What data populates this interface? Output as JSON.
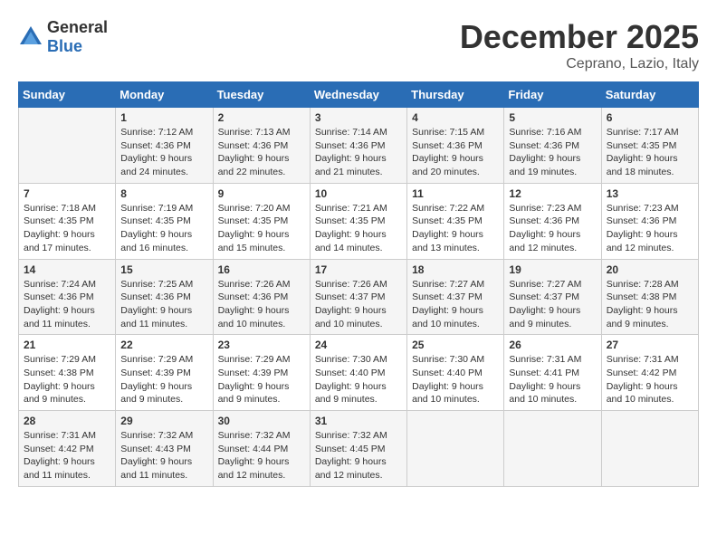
{
  "logo": {
    "general": "General",
    "blue": "Blue"
  },
  "title": "December 2025",
  "location": "Ceprano, Lazio, Italy",
  "days_header": [
    "Sunday",
    "Monday",
    "Tuesday",
    "Wednesday",
    "Thursday",
    "Friday",
    "Saturday"
  ],
  "weeks": [
    [
      {
        "day": "",
        "sunrise": "",
        "sunset": "",
        "daylight": ""
      },
      {
        "day": "1",
        "sunrise": "Sunrise: 7:12 AM",
        "sunset": "Sunset: 4:36 PM",
        "daylight": "Daylight: 9 hours and 24 minutes."
      },
      {
        "day": "2",
        "sunrise": "Sunrise: 7:13 AM",
        "sunset": "Sunset: 4:36 PM",
        "daylight": "Daylight: 9 hours and 22 minutes."
      },
      {
        "day": "3",
        "sunrise": "Sunrise: 7:14 AM",
        "sunset": "Sunset: 4:36 PM",
        "daylight": "Daylight: 9 hours and 21 minutes."
      },
      {
        "day": "4",
        "sunrise": "Sunrise: 7:15 AM",
        "sunset": "Sunset: 4:36 PM",
        "daylight": "Daylight: 9 hours and 20 minutes."
      },
      {
        "day": "5",
        "sunrise": "Sunrise: 7:16 AM",
        "sunset": "Sunset: 4:36 PM",
        "daylight": "Daylight: 9 hours and 19 minutes."
      },
      {
        "day": "6",
        "sunrise": "Sunrise: 7:17 AM",
        "sunset": "Sunset: 4:35 PM",
        "daylight": "Daylight: 9 hours and 18 minutes."
      }
    ],
    [
      {
        "day": "7",
        "sunrise": "Sunrise: 7:18 AM",
        "sunset": "Sunset: 4:35 PM",
        "daylight": "Daylight: 9 hours and 17 minutes."
      },
      {
        "day": "8",
        "sunrise": "Sunrise: 7:19 AM",
        "sunset": "Sunset: 4:35 PM",
        "daylight": "Daylight: 9 hours and 16 minutes."
      },
      {
        "day": "9",
        "sunrise": "Sunrise: 7:20 AM",
        "sunset": "Sunset: 4:35 PM",
        "daylight": "Daylight: 9 hours and 15 minutes."
      },
      {
        "day": "10",
        "sunrise": "Sunrise: 7:21 AM",
        "sunset": "Sunset: 4:35 PM",
        "daylight": "Daylight: 9 hours and 14 minutes."
      },
      {
        "day": "11",
        "sunrise": "Sunrise: 7:22 AM",
        "sunset": "Sunset: 4:35 PM",
        "daylight": "Daylight: 9 hours and 13 minutes."
      },
      {
        "day": "12",
        "sunrise": "Sunrise: 7:23 AM",
        "sunset": "Sunset: 4:36 PM",
        "daylight": "Daylight: 9 hours and 12 minutes."
      },
      {
        "day": "13",
        "sunrise": "Sunrise: 7:23 AM",
        "sunset": "Sunset: 4:36 PM",
        "daylight": "Daylight: 9 hours and 12 minutes."
      }
    ],
    [
      {
        "day": "14",
        "sunrise": "Sunrise: 7:24 AM",
        "sunset": "Sunset: 4:36 PM",
        "daylight": "Daylight: 9 hours and 11 minutes."
      },
      {
        "day": "15",
        "sunrise": "Sunrise: 7:25 AM",
        "sunset": "Sunset: 4:36 PM",
        "daylight": "Daylight: 9 hours and 11 minutes."
      },
      {
        "day": "16",
        "sunrise": "Sunrise: 7:26 AM",
        "sunset": "Sunset: 4:36 PM",
        "daylight": "Daylight: 9 hours and 10 minutes."
      },
      {
        "day": "17",
        "sunrise": "Sunrise: 7:26 AM",
        "sunset": "Sunset: 4:37 PM",
        "daylight": "Daylight: 9 hours and 10 minutes."
      },
      {
        "day": "18",
        "sunrise": "Sunrise: 7:27 AM",
        "sunset": "Sunset: 4:37 PM",
        "daylight": "Daylight: 9 hours and 10 minutes."
      },
      {
        "day": "19",
        "sunrise": "Sunrise: 7:27 AM",
        "sunset": "Sunset: 4:37 PM",
        "daylight": "Daylight: 9 hours and 9 minutes."
      },
      {
        "day": "20",
        "sunrise": "Sunrise: 7:28 AM",
        "sunset": "Sunset: 4:38 PM",
        "daylight": "Daylight: 9 hours and 9 minutes."
      }
    ],
    [
      {
        "day": "21",
        "sunrise": "Sunrise: 7:29 AM",
        "sunset": "Sunset: 4:38 PM",
        "daylight": "Daylight: 9 hours and 9 minutes."
      },
      {
        "day": "22",
        "sunrise": "Sunrise: 7:29 AM",
        "sunset": "Sunset: 4:39 PM",
        "daylight": "Daylight: 9 hours and 9 minutes."
      },
      {
        "day": "23",
        "sunrise": "Sunrise: 7:29 AM",
        "sunset": "Sunset: 4:39 PM",
        "daylight": "Daylight: 9 hours and 9 minutes."
      },
      {
        "day": "24",
        "sunrise": "Sunrise: 7:30 AM",
        "sunset": "Sunset: 4:40 PM",
        "daylight": "Daylight: 9 hours and 9 minutes."
      },
      {
        "day": "25",
        "sunrise": "Sunrise: 7:30 AM",
        "sunset": "Sunset: 4:40 PM",
        "daylight": "Daylight: 9 hours and 10 minutes."
      },
      {
        "day": "26",
        "sunrise": "Sunrise: 7:31 AM",
        "sunset": "Sunset: 4:41 PM",
        "daylight": "Daylight: 9 hours and 10 minutes."
      },
      {
        "day": "27",
        "sunrise": "Sunrise: 7:31 AM",
        "sunset": "Sunset: 4:42 PM",
        "daylight": "Daylight: 9 hours and 10 minutes."
      }
    ],
    [
      {
        "day": "28",
        "sunrise": "Sunrise: 7:31 AM",
        "sunset": "Sunset: 4:42 PM",
        "daylight": "Daylight: 9 hours and 11 minutes."
      },
      {
        "day": "29",
        "sunrise": "Sunrise: 7:32 AM",
        "sunset": "Sunset: 4:43 PM",
        "daylight": "Daylight: 9 hours and 11 minutes."
      },
      {
        "day": "30",
        "sunrise": "Sunrise: 7:32 AM",
        "sunset": "Sunset: 4:44 PM",
        "daylight": "Daylight: 9 hours and 12 minutes."
      },
      {
        "day": "31",
        "sunrise": "Sunrise: 7:32 AM",
        "sunset": "Sunset: 4:45 PM",
        "daylight": "Daylight: 9 hours and 12 minutes."
      },
      {
        "day": "",
        "sunrise": "",
        "sunset": "",
        "daylight": ""
      },
      {
        "day": "",
        "sunrise": "",
        "sunset": "",
        "daylight": ""
      },
      {
        "day": "",
        "sunrise": "",
        "sunset": "",
        "daylight": ""
      }
    ]
  ]
}
